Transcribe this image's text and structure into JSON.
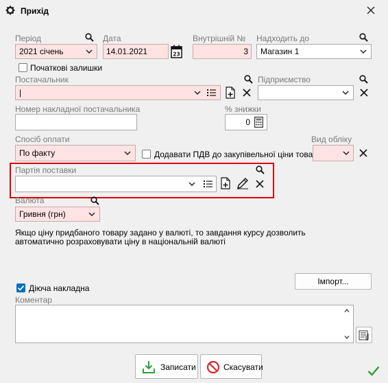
{
  "window": {
    "title": "Прихід"
  },
  "period": {
    "label": "Період",
    "value": "2021 січень"
  },
  "date": {
    "label": "Дата",
    "value": "14.01.2021"
  },
  "internal_no": {
    "label": "Внутрішній №",
    "value": "3"
  },
  "arrives_to": {
    "label": "Надходить до",
    "value": "Магазин 1"
  },
  "opening_balances": {
    "label": "Початкові залишки",
    "checked": false
  },
  "supplier": {
    "label": "Постачальник",
    "value": "|"
  },
  "enterprise": {
    "label": "Підприємство",
    "value": ""
  },
  "supplier_invoice_no": {
    "label": "Номер накладної постачальника",
    "value": ""
  },
  "discount": {
    "label": "% знижки",
    "value": "0"
  },
  "payment_method": {
    "label": "Спосіб оплати",
    "value": "По факту"
  },
  "add_vat": {
    "label": "Додавати ПДВ до закупівельної ціни товару",
    "checked": false
  },
  "accounting_type": {
    "label": "Вид обліку",
    "value": ""
  },
  "batch": {
    "label": "Партія поставки",
    "value": ""
  },
  "currency": {
    "label": "Валюта",
    "value": "Гривня (грн)"
  },
  "currency_note": {
    "line1": "Якщо ціну придбаного товару задано у валюті, то завдання курсу дозволить",
    "line2": "автоматично розраховувати ціну в національній валюті"
  },
  "import_button": {
    "label": "Імпорт..."
  },
  "active_invoice": {
    "label": "Діюча накладна",
    "checked": true
  },
  "comment": {
    "label": "Коментар",
    "value": ""
  },
  "save_button": {
    "label": "Записати"
  },
  "cancel_button": {
    "label": "Скасувати"
  },
  "colors": {
    "required_bg": "#ffe3e3",
    "highlight": "#e00000",
    "accent_green": "#2e9e3a",
    "cancel_red": "#d8262d"
  }
}
